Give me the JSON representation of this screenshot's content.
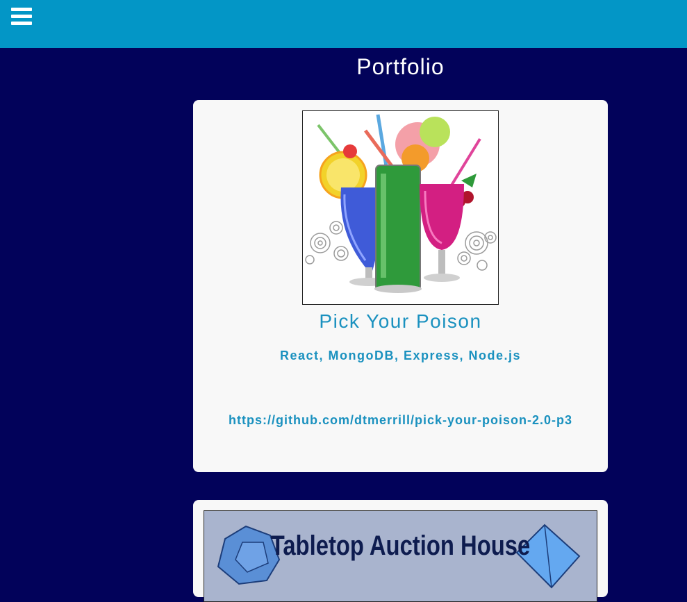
{
  "nav": {
    "menu_icon": "hamburger-menu-icon"
  },
  "page": {
    "title": "Portfolio"
  },
  "projects": [
    {
      "title": "Pick Your Poison",
      "tech": "React, MongoDB, Express, Node.js",
      "link": "https://github.com/dtmerrill/pick-your-poison-2.0-p3",
      "image": "cocktail-drinks-illustration"
    },
    {
      "image_text": "Tabletop Auction House",
      "image": "tabletop-auction-house-banner"
    }
  ],
  "colors": {
    "topbar": "#0396c6",
    "background": "#02025a",
    "card": "#f8f8f8",
    "accent": "#1a91bf"
  }
}
